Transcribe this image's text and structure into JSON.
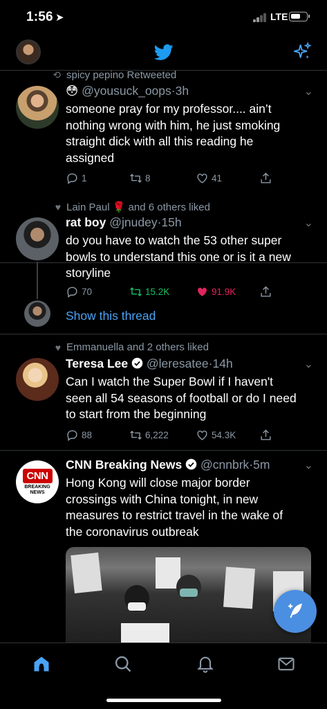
{
  "status_bar": {
    "time": "1:56",
    "network": "LTE"
  },
  "header": {
    "logo": "twitter-bird-icon",
    "action_icon": "sparkle-icon"
  },
  "tweets": [
    {
      "context": "spicy pepino Retweeted",
      "context_icon": "retweet-icon",
      "name_emoji": "😳",
      "handle": "@yousuck_oops",
      "time": "3h",
      "text": "someone pray for my professor.... ain’t nothing wrong with him, he just smoking straight dick with all this reading he assigned",
      "replies": "1",
      "retweets": "8",
      "likes": "41"
    },
    {
      "context": "Lain Paul 🌹 and 6 others liked",
      "context_icon": "heart-icon",
      "name": "rat boy",
      "handle": "@jnudey",
      "time": "15h",
      "text": "do you have to watch the 53 other super bowls to understand this one or is it a new storyline",
      "replies": "70",
      "retweets": "15.2K",
      "likes": "91.9K",
      "thread_link": "Show this thread"
    },
    {
      "context": "Emmanuella and 2 others liked",
      "context_icon": "heart-icon",
      "name": "Teresa Lee",
      "handle": "@leresatee",
      "time": "14h",
      "text": "Can I watch the Super Bowl if I haven't seen all 54 seasons of football or do I need to start from the beginning",
      "replies": "88",
      "retweets": "6,222",
      "likes": "54.3K"
    },
    {
      "name": "CNN Breaking News",
      "handle": "@cnnbrk",
      "time": "5m",
      "text": "Hong Kong will close major border crossings with China tonight, in new measures to restrict travel in the wake of the coronavirus outbreak",
      "avatar_logo": "CNN",
      "avatar_sub": "BREAKING NEWS"
    }
  ],
  "separator": "·",
  "colors": {
    "accent": "#4aa3f5",
    "retweeted": "#17bf63",
    "liked": "#e0245e",
    "muted": "#8b98a5"
  }
}
